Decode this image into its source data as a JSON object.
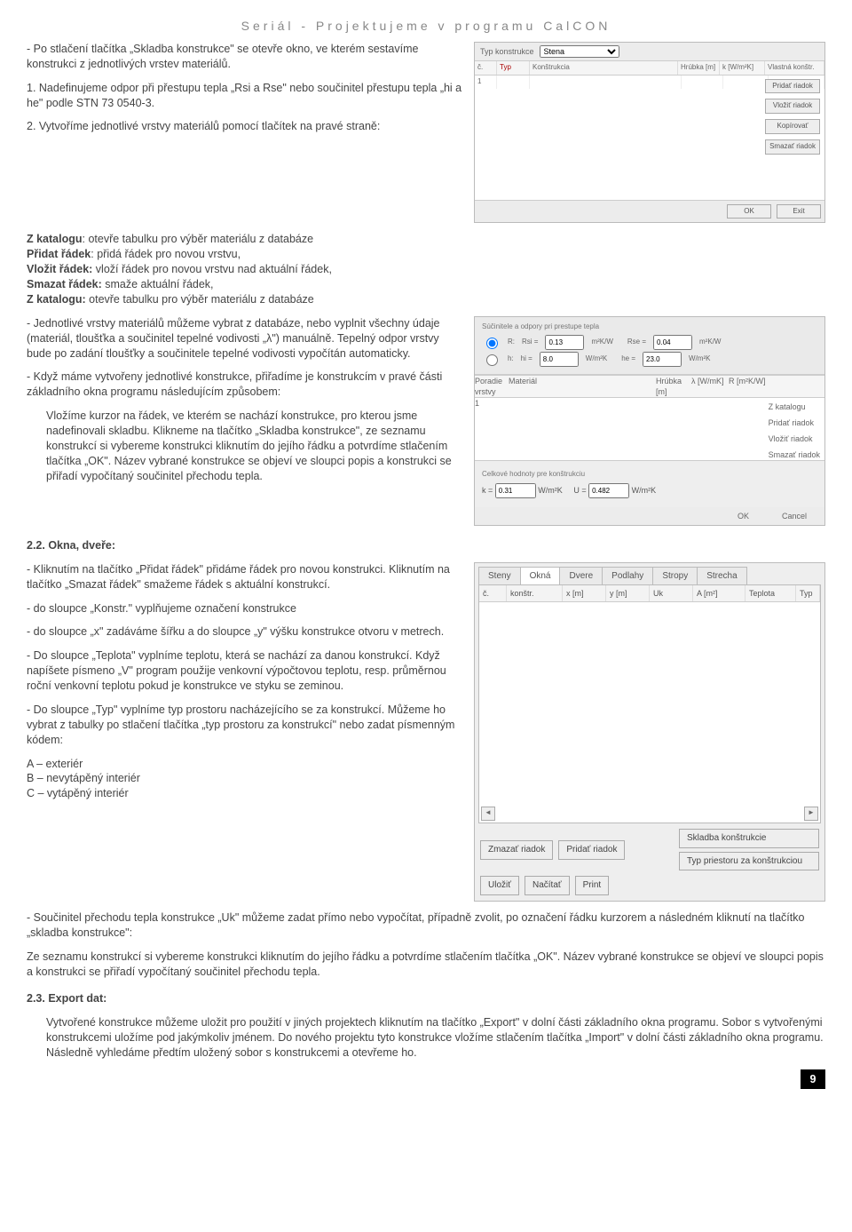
{
  "header": {
    "series": "Seriál - Projektujeme v programu CalCON"
  },
  "p_intro": "- Po stlačení tlačítka „Skladba konstrukce\" se otevře okno, ve kterém sestavíme konstrukci z jednotlivých vrstev materiálů.",
  "p_step1": "1. Nadefinujeme odpor při přestupu tepla „Rsi a Rse\" nebo součinitel přestupu tepla „hi a he\" podle STN 73 0540-3.",
  "p_step2": "2. Vytvoříme jednotlivé vrstvy materiálů pomocí tlačítek na pravé straně:",
  "list1": {
    "l1b": "Z katalogu",
    "l1t": ": otevře tabulku pro výběr materiálu z databáze",
    "l2b": "Přidat řádek",
    "l2t": ": přidá řádek pro novou vrstvu,",
    "l3b": "Vložit řádek:",
    "l3t": " vloží řádek pro novou vrstvu            nad aktuální řádek,",
    "l4b": "Smazat řádek:",
    "l4t": " smaže aktuální řádek,",
    "l5b": "Z katalogu:",
    "l5t": " otevře tabulku pro výběr materiálu z databáze"
  },
  "p_layers": "- Jednotlivé vrstvy materiálů můžeme vybrat z databáze, nebo vyplnit všechny údaje (materiál, tloušťka a součinitel tepelné vodivosti „λ\") manuálně. Tepelný odpor vrstvy bude po zadání tloušťky a součinitele tepelné vodivosti vypočítán automaticky.",
  "p_assign": "- Když máme vytvořeny jednotlivé konstrukce, přiřadíme je konstrukcím v pravé části základního okna programu následujícím způsobem:",
  "p_cursor": "Vložíme kurzor na řádek, ve kterém se nachází konstrukce, pro kterou  jsme nadefinovali skladbu. Klikneme na tlačítko „Skladba konstrukce\", ze seznamu konstrukcí si vybereme konstrukci kliknutím do jejího řádku a potvrdíme stlačením tlačítka „OK\". Název vybrané konstrukce se objeví ve sloupci popis a konstrukci se přiřadí vypočítaný součinitel přechodu tepla.",
  "sect22": " 2.2. Okna, dveře:",
  "p_okna1": "-    Kliknutím na tlačítko „Přidat řádek\" přidáme řádek pro novou konstrukci. Kliknutím na tlačítko „Smazat řádek\" smažeme řádek s aktuální konstrukcí.",
  "p_okna2": "-    do sloupce „Konstr.\" vyplňujeme označení konstrukce",
  "p_okna3": "-    do sloupce „x\" zadáváme šířku a do sloupce „y\" výšku konstrukce otvoru v metrech.",
  "p_okna4": "-    Do sloupce „Teplota\" vyplníme teplotu, která se nachází za danou konstrukcí. Když napíšete písmeno „V\" program použije venkovní výpočtovou teplotu, resp. průměrnou roční venkovní teplotu pokud je konstrukce ve styku se zeminou.",
  "p_okna5": "-    Do sloupce „Typ\" vyplníme typ prostoru nacházejícího se za konstrukcí. Můžeme ho vybrat z tabulky po stlačení tlačítka „typ prostoru za konstrukcí\" nebo zadat písmenným kódem:",
  "codes": {
    "a": "A – exteriér",
    "b": "B – nevytápěný interiér",
    "c": "C – vytápěný interiér"
  },
  "p_uk": "-     Součinitel přechodu tepla konstrukce „Uk\" můžeme zadat přímo nebo vypočítat, případně zvolit, po označení řádku kurzorem a následném kliknutí na tlačítko „skladba konstrukce\":",
  "p_uk2": "Ze seznamu konstrukcí si vybereme konstrukci kliknutím do jejího řádku a potvrdíme stlačením tlačítka „OK\". Název vybrané konstrukce se objeví ve sloupci popis a konstrukci se přiřadí vypočítaný součinitel přechodu tepla.",
  "sect23": "2.3.      Export dat:",
  "p_export": "Vytvořené konstrukce můžeme uložit pro použití v jiných projektech kliknutím na tlačítko „Export\" v dolní části základního okna programu. Sobor s vytvořenými konstrukcemi uložíme pod jakýmkoliv jménem. Do nového projektu tyto konstrukce vložíme stlačením tlačítka „Import\" v dolní části základního okna programu. Následně vyhledáme předtím uložený sobor s konstrukcemi a otevřeme ho.",
  "page_num": "9",
  "s1": {
    "typ_label": "Typ konstrukce",
    "select": "Stena",
    "cols": [
      "č.",
      "Typ",
      "Konštrukcia",
      "Hrúbka [m]",
      "k [W/m²K]",
      "Vlastná konštr."
    ],
    "buttons": [
      "Pridať riadok",
      "Vložiť riadok",
      "Kopírovať",
      "Smazať riadok"
    ],
    "ok": "OK",
    "exit": "Exit"
  },
  "s2": {
    "group_title": "Súčinitele a odpory pri prestupe tepla",
    "r1": {
      "opt": "R:",
      "rsi": "Rsi =",
      "rsi_v": "0.13",
      "u1": "m²K/W",
      "rse": "Rse =",
      "rse_v": "0.04",
      "u2": "m²K/W"
    },
    "r2": {
      "opt": "h:",
      "hi": "hi =",
      "hi_v": "8.0",
      "u1": "W/m²K",
      "he": "he =",
      "he_v": "23.0",
      "u2": "W/m²K"
    },
    "cols": [
      "Poradie vrstvy",
      "Materiál",
      "Hrúbka [m]",
      "λ [W/mK]",
      "R [m²K/W]"
    ],
    "buttons": [
      "Z katalogu",
      "Pridať riadok",
      "Vložiť riadok",
      "Smazať riadok"
    ],
    "tot_title": "Celkové hodnoty pre konštrukciu",
    "tot_k": "k =",
    "tot_k_v": "0.31",
    "tot_ku": "W/m²K",
    "tot_u": "U =",
    "tot_u_v": "0.482",
    "tot_uu": "W/m²K",
    "ok": "OK",
    "cancel": "Cancel"
  },
  "s3": {
    "tabs": [
      "Steny",
      "Okná",
      "Dvere",
      "Podlahy",
      "Stropy",
      "Strecha"
    ],
    "cols": [
      "č.",
      "konštr.",
      "x [m]",
      "y [m]",
      "Uk",
      "A [m²]",
      "Teplota",
      "Typ"
    ],
    "btns_left": [
      "Zmazať riadok",
      "Pridať riadok"
    ],
    "btns_right": [
      "Skladba konštrukcie",
      "Typ priestoru za konštrukciou"
    ],
    "btns_bot": [
      "Uložiť",
      "Načítať",
      "Print"
    ]
  }
}
